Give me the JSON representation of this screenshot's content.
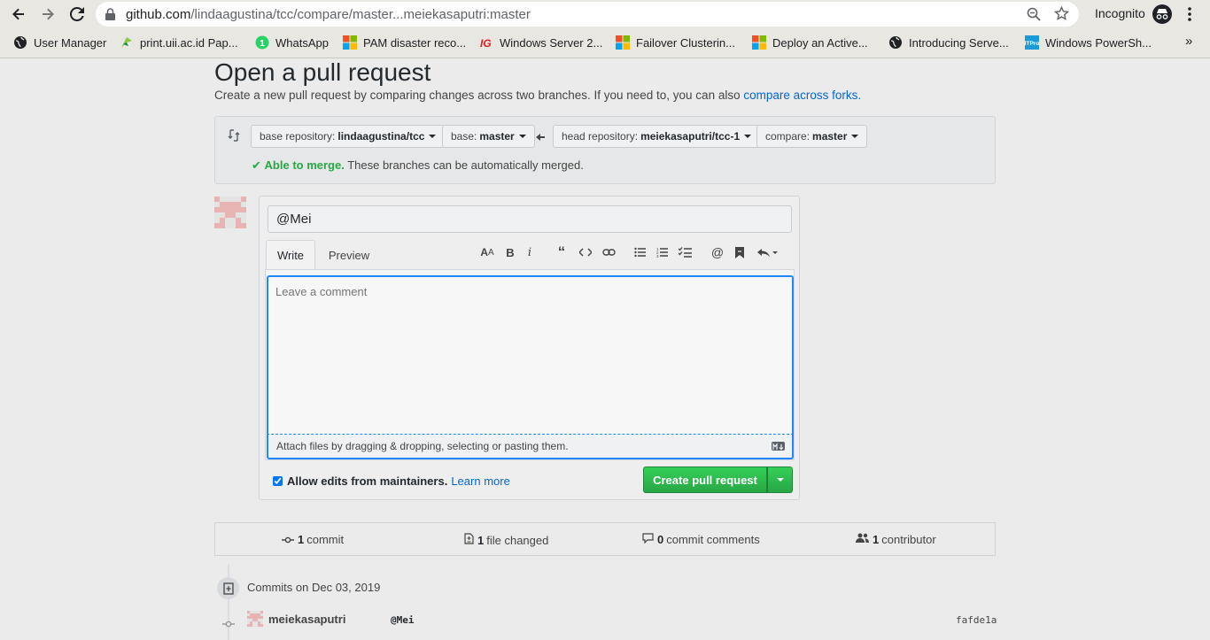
{
  "browser": {
    "url_domain": "github.com",
    "url_path": "/lindaagustina/tcc/compare/master...meiekasaputri:master",
    "profile_label": "Incognito",
    "bookmarks": [
      {
        "label": "User Manager",
        "icon": "globe-icon"
      },
      {
        "label": "print.uii.ac.id Pap...",
        "icon": "printer-leaf-icon"
      },
      {
        "label": "WhatsApp",
        "icon": "whatsapp-icon"
      },
      {
        "label": "PAM disaster reco...",
        "icon": "microsoft-icon"
      },
      {
        "label": "Windows Server 2...",
        "icon": "ig-icon"
      },
      {
        "label": "Failover Clusterin...",
        "icon": "microsoft-icon"
      },
      {
        "label": "Deploy an Active...",
        "icon": "microsoft-icon"
      },
      {
        "label": "Introducing Serve...",
        "icon": "globe-icon"
      },
      {
        "label": "Windows PowerSh...",
        "icon": "itpro-icon"
      }
    ],
    "overflow_label": "»"
  },
  "page": {
    "title": "Open a pull request",
    "subtitle": "Create a new pull request by comparing changes across two branches. If you need to, you can also ",
    "subtitle_link": "compare across forks."
  },
  "range": {
    "base_repo_label": "base repository:",
    "base_repo_value": "lindaagustina/tcc",
    "base_label": "base:",
    "base_value": "master",
    "head_repo_label": "head repository:",
    "head_repo_value": "meiekasaputri/tcc-1",
    "compare_label": "compare:",
    "compare_value": "master",
    "merge_ok": "Able to merge.",
    "merge_text": " These branches can be automatically merged."
  },
  "form": {
    "title_value": "@Mei",
    "tab_write": "Write",
    "tab_preview": "Preview",
    "comment_placeholder": "Leave a comment",
    "attach_text": "Attach files by dragging & dropping, selecting or pasting them.",
    "allow_edits_label": "Allow edits from maintainers.",
    "allow_edits_checked": true,
    "learn_more": "Learn more",
    "create_button": "Create pull request"
  },
  "summary": {
    "commits_count": "1",
    "commits_label": "commit",
    "files_count": "1",
    "files_label": "file changed",
    "comments_count": "0",
    "comments_label": "commit comments",
    "contributors_count": "1",
    "contributors_label": "contributor"
  },
  "commits": {
    "group_label": "Commits on Dec 03, 2019",
    "items": [
      {
        "author": "meiekasaputri",
        "message": "@Mei",
        "sha": "fafde1a"
      }
    ]
  },
  "colors": {
    "accent_link": "#0366d6",
    "merge_ok": "#28a745",
    "create_button": "#28a745",
    "focus_border": "#2188ff"
  }
}
